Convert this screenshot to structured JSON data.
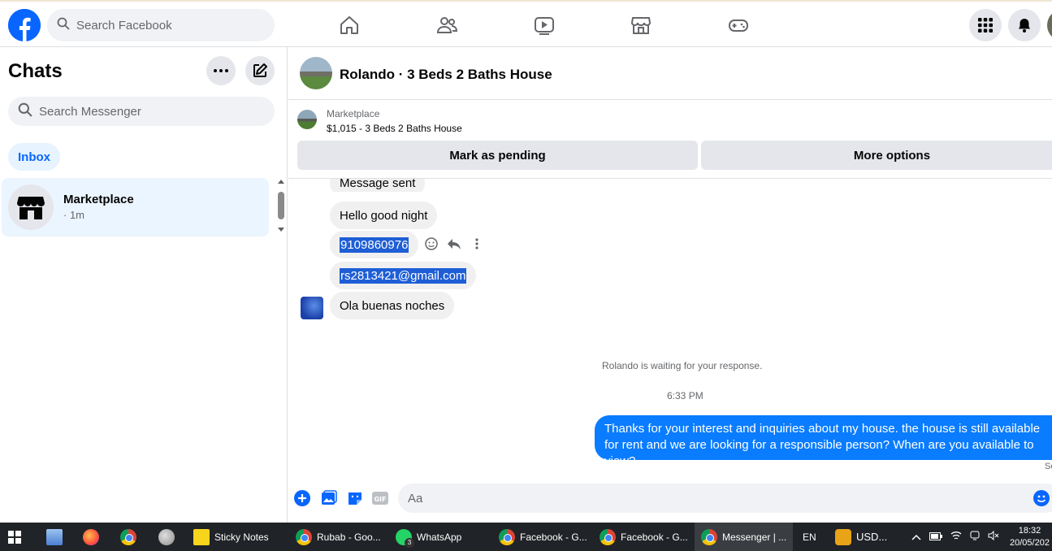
{
  "topbar": {
    "search_placeholder": "Search Facebook",
    "nav": [
      "home-icon",
      "friends-icon",
      "watch-icon",
      "marketplace-icon",
      "gaming-icon"
    ],
    "brand_color": "#0866ff"
  },
  "sidebar": {
    "title": "Chats",
    "search_placeholder": "Search Messenger",
    "filter": "Inbox",
    "conversations": [
      {
        "name": "Marketplace",
        "time": "· 1m"
      }
    ]
  },
  "chat": {
    "header_title": "Rolando · 3 Beds 2 Baths House",
    "marketplace_label": "Marketplace",
    "listing": "$1,015 - 3 Beds 2 Baths House",
    "mark_pending": "Mark as pending",
    "more_options": "More options",
    "messages": [
      {
        "text": "Message sent"
      },
      {
        "text": "Hello good night"
      },
      {
        "text": "9109860976"
      },
      {
        "text": "rs2813421@gmail.com"
      },
      {
        "text": "Ola buenas noches"
      }
    ],
    "waiting_notice": "Rolando is waiting for your response.",
    "timestamp": "6:33 PM",
    "outgoing": "Thanks for your interest and inquiries about my house. the house is still available for rent and we are looking for a responsible person? When are you available to view?",
    "seen_label": "Se",
    "composer_placeholder": "Aa",
    "outgoing_color": "#0a7cff"
  },
  "taskbar": {
    "items": [
      {
        "label": "Sticky Notes"
      },
      {
        "label": "Rubab - Goo..."
      },
      {
        "label": "WhatsApp"
      },
      {
        "label": "Facebook - G..."
      },
      {
        "label": "Facebook - G..."
      },
      {
        "label": "Messenger | ..."
      }
    ],
    "whatsapp_badge": "3",
    "language": "EN",
    "currency": "USD...",
    "time": "18:32",
    "date": "20/05/202"
  }
}
